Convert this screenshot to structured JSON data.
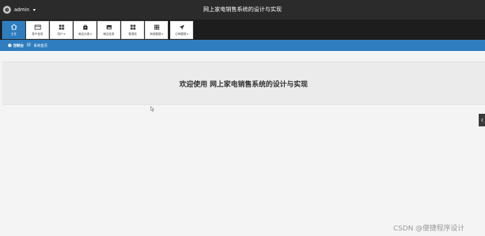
{
  "header": {
    "username": "admin",
    "title": "网上家电销售系统的设计与实现"
  },
  "nav": {
    "items": [
      {
        "label": "主页",
        "icon": "home-icon"
      },
      {
        "label": "用户信息",
        "icon": "id-card-icon"
      },
      {
        "label": "用户",
        "icon": "grid-icon"
      },
      {
        "label": "商品分类",
        "icon": "bag-icon"
      },
      {
        "label": "商品信息",
        "icon": "image-icon"
      },
      {
        "label": "管理员",
        "icon": "grid-icon"
      },
      {
        "label": "系统管理",
        "icon": "table-icon"
      },
      {
        "label": "订单管理",
        "icon": "send-icon"
      }
    ]
  },
  "breadcrumb": {
    "home": "控制台",
    "current": "系统首页"
  },
  "welcome": {
    "text": "欢迎使用 网上家电销售系统的设计与实现"
  },
  "watermark": "CSDN @便捷程序设计",
  "colors": {
    "topbar": "#2b2b2b",
    "accent": "#2f7dbf",
    "background": "#f4f4f5"
  }
}
